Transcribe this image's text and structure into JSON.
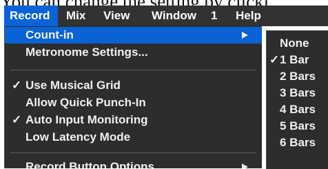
{
  "caption": "You can change the setting by clicki",
  "menubar": {
    "items": [
      "Record",
      "Mix",
      "View",
      "Window",
      "1",
      "Help"
    ],
    "active": "Record"
  },
  "record_menu": {
    "items": [
      {
        "label": "Count-in",
        "checked": false,
        "submenu": true,
        "highlighted": true
      },
      {
        "label": "Metronome Settings...",
        "checked": false,
        "submenu": false
      },
      {
        "label": "Use Musical Grid",
        "checked": true,
        "submenu": false
      },
      {
        "label": "Allow Quick Punch-In",
        "checked": false,
        "submenu": false
      },
      {
        "label": "Auto Input Monitoring",
        "checked": true,
        "submenu": false
      },
      {
        "label": "Low Latency Mode",
        "checked": false,
        "submenu": false
      },
      {
        "label": "Record Button Options",
        "checked": false,
        "submenu": true
      }
    ],
    "check_glyph": "✓"
  },
  "countin_submenu": {
    "items": [
      {
        "label": "None",
        "checked": false
      },
      {
        "label": "1 Bar",
        "checked": true
      },
      {
        "label": "2 Bars",
        "checked": false
      },
      {
        "label": "3 Bars",
        "checked": false
      },
      {
        "label": "4 Bars",
        "checked": false
      },
      {
        "label": "5 Bars",
        "checked": false
      },
      {
        "label": "6 Bars",
        "checked": false
      }
    ]
  },
  "colors": {
    "menubar_bg": "#323232",
    "menu_bg": "#2d2d2d",
    "highlight": "#0a63d6",
    "text": "#f0f0f0"
  }
}
